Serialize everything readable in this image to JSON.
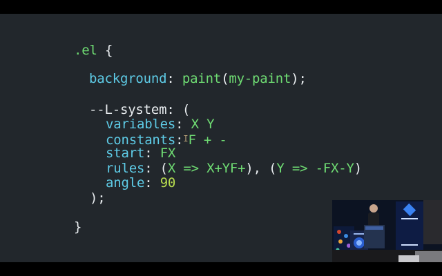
{
  "code": {
    "selector": ".el",
    "open_brace": "{",
    "background_prop": "background",
    "background_fn": "paint",
    "background_arg": "my-paint",
    "custom_prop": "--L-system",
    "open_paren": "(",
    "variables_key": "variables",
    "variables_val": "X Y",
    "constants_key": "constants",
    "constants_val": "F + -",
    "start_key": "start",
    "start_val": "FX",
    "rules_key": "rules",
    "rule1_lhs": "X",
    "rule1_arrow": "=>",
    "rule1_rhs": "X+YF+",
    "rule2_lhs": "Y",
    "rule2_arrow": "=>",
    "rule2_rhs": "-FX-Y",
    "angle_key": "angle",
    "angle_val": "90",
    "close_paren": ");",
    "close_brace": "}"
  },
  "colors": {
    "slide_bg": "#22272c",
    "selector": "#6fdc73",
    "property": "#5ecbe6",
    "text": "#e8ecef",
    "number": "#b7dd4f"
  }
}
